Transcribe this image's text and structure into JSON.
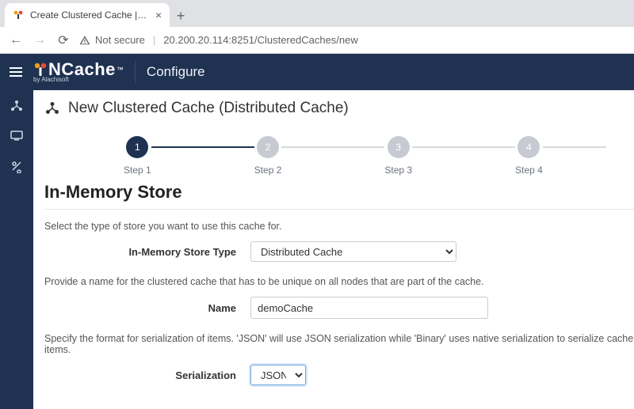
{
  "browser": {
    "tab_title": "Create Clustered Cache | NCache",
    "security_label": "Not secure",
    "url": "20.200.20.114:8251/ClusteredCaches/new"
  },
  "header": {
    "brand_main": "NCache",
    "brand_sub": "by Alachisoft",
    "section": "Configure"
  },
  "page": {
    "title": "New Clustered Cache (Distributed Cache)"
  },
  "stepper": {
    "steps": [
      {
        "num": "1",
        "label": "Step 1",
        "active": true
      },
      {
        "num": "2",
        "label": "Step 2",
        "active": false
      },
      {
        "num": "3",
        "label": "Step 3",
        "active": false
      },
      {
        "num": "4",
        "label": "Step 4",
        "active": false
      }
    ]
  },
  "section": {
    "heading": "In-Memory Store",
    "store_help": "Select the type of store you want to use this cache for.",
    "store_label": "In-Memory Store Type",
    "store_value": "Distributed Cache",
    "name_help": "Provide a name for the clustered cache that has to be unique on all nodes that are part of the cache.",
    "name_label": "Name",
    "name_value": "demoCache",
    "serial_help": "Specify the format for serialization of items. 'JSON' will use JSON serialization while 'Binary' uses native serialization to serialize cache items.",
    "serial_label": "Serialization",
    "serial_value": "JSON"
  }
}
